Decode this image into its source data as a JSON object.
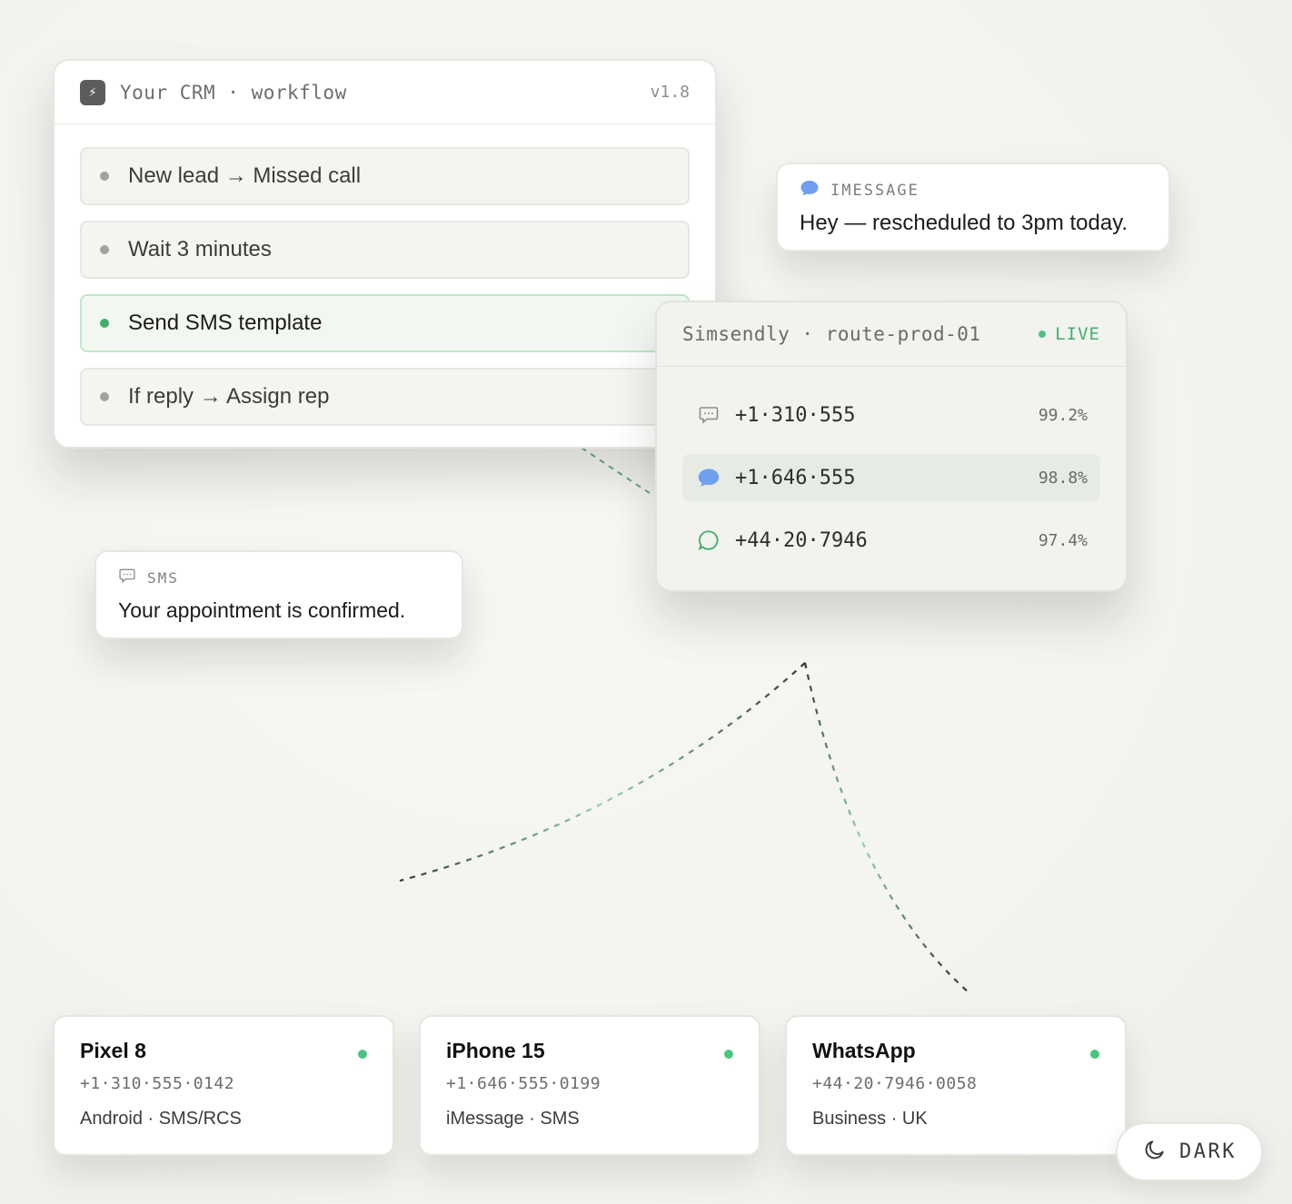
{
  "crm": {
    "logo_glyph": "⚡",
    "title": "Your CRM · workflow",
    "version": "v1.8",
    "steps": [
      {
        "label": "New lead → Missed call"
      },
      {
        "label": "Wait 3 minutes"
      },
      {
        "label": "Send SMS template",
        "active": true
      },
      {
        "label": "If reply → Assign rep"
      }
    ]
  },
  "imessage": {
    "tag": "IMESSAGE",
    "icon": "imessage-bubble-icon",
    "text": "Hey — rescheduled to 3pm today."
  },
  "sms": {
    "tag": "SMS",
    "icon": "sms-bubble-icon",
    "text": "Your appointment is confirmed."
  },
  "router": {
    "title": "Simsendly · route-prod-01",
    "status": "LIVE",
    "routes": [
      {
        "icon": "sms-bubble-icon",
        "number": "+1·310·555",
        "rate": "99.2%"
      },
      {
        "icon": "imessage-bubble-icon",
        "number": "+1·646·555",
        "rate": "98.8%",
        "highlighted": true
      },
      {
        "icon": "whatsapp-bubble-icon",
        "number": "+44·20·7946",
        "rate": "97.4%"
      }
    ]
  },
  "devices": [
    {
      "name": "Pixel 8",
      "number": "+1·310·555·0142",
      "meta": "Android · SMS/RCS",
      "online": true
    },
    {
      "name": "iPhone 15",
      "number": "+1·646·555·0199",
      "meta": "iMessage · SMS",
      "online": true
    },
    {
      "name": "WhatsApp",
      "number": "+44·20·7946·0058",
      "meta": "Business · UK",
      "online": true
    }
  ],
  "theme_toggle": {
    "label": "DARK",
    "icon": "moon-icon"
  },
  "colors": {
    "accent_green": "#3fae6c",
    "imessage_blue": "#6f9ff0",
    "background": "#f3f3ef"
  }
}
